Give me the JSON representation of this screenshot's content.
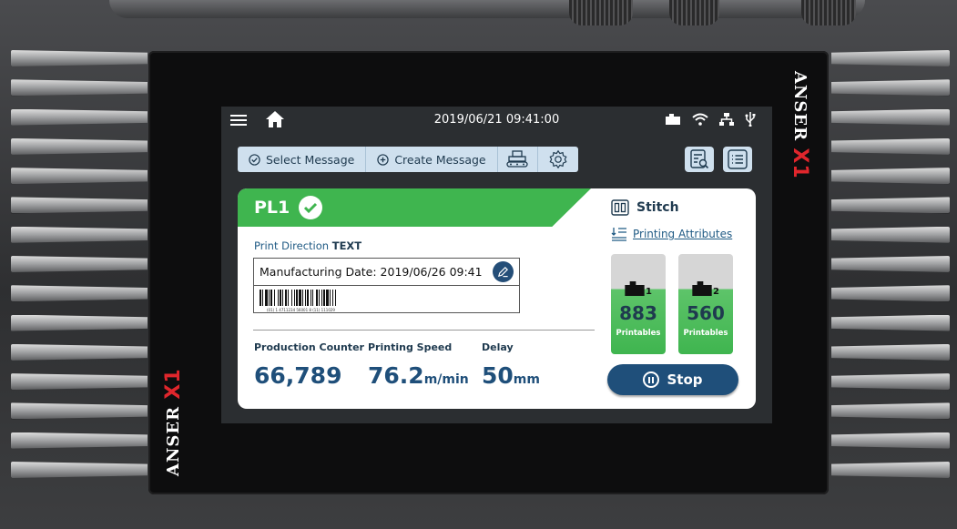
{
  "device": {
    "brand_name": "ANSER",
    "brand_model": "X1"
  },
  "status_bar": {
    "datetime": "2019/06/21 09:41:00",
    "icons": [
      "menu-icon",
      "home-icon",
      "ink-cartridge-icon",
      "wifi-icon",
      "network-icon",
      "usb-icon"
    ]
  },
  "toolbar": {
    "select_message": "Select Message",
    "create_message": "Create Message",
    "icons": [
      "conveyor-icon",
      "gear-icon",
      "report-icon",
      "list-icon"
    ]
  },
  "job": {
    "line": "PL1",
    "status": "ok",
    "print_direction_label": "Print Direction",
    "print_direction_value": "TEXT",
    "message_text": "Manufacturing Date: 2019/06/26 09:41",
    "barcode_text": "(01) 1 4711234 56001 8 (11) 111029"
  },
  "stats": {
    "production_counter_label": "Production Counter",
    "production_counter_value": "66,789",
    "printing_speed_label": "Printing Speed",
    "printing_speed_value": "76.2",
    "printing_speed_unit": "m/min",
    "delay_label": "Delay",
    "delay_value": "50",
    "delay_unit": "mm"
  },
  "side_panel": {
    "mode": "Stitch",
    "attributes_link": "Printing Attributes",
    "cartridges": [
      {
        "number": "1",
        "count": "883",
        "label": "Printables"
      },
      {
        "number": "2",
        "count": "560",
        "label": "Printables"
      }
    ],
    "stop_label": "Stop"
  },
  "colors": {
    "accent_green": "#3fb54f",
    "accent_blue": "#1f4f7a",
    "brand_red": "#e0262c"
  }
}
